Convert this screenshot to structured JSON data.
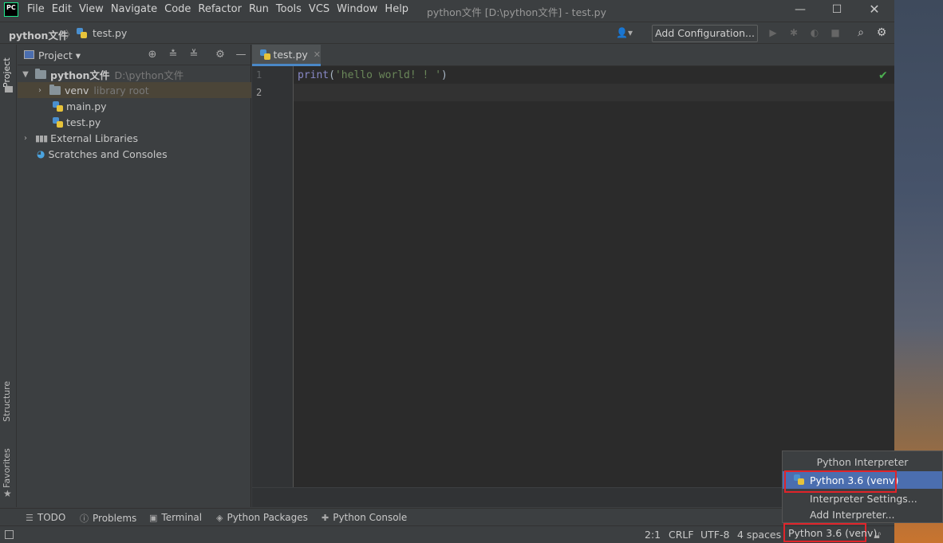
{
  "titlebar": {
    "logo": "PC",
    "menu": [
      "File",
      "Edit",
      "View",
      "Navigate",
      "Code",
      "Refactor",
      "Run",
      "Tools",
      "VCS",
      "Window",
      "Help"
    ],
    "window_title": "python文件 [D:\\python文件] - test.py",
    "controls": [
      "minimize",
      "maximize",
      "close"
    ]
  },
  "navbar": {
    "project": "python文件",
    "file": "test.py",
    "add_configuration": "Add Configuration..."
  },
  "left_strip": {
    "project_tab": "Project",
    "structure_tab": "Structure",
    "favorites_tab": "Favorites"
  },
  "project_panel": {
    "title": "Project",
    "tree": [
      {
        "label": "python文件",
        "hint": "D:\\python文件",
        "type": "folder",
        "expanded": true
      },
      {
        "label": "venv",
        "hint": "library root",
        "type": "folder",
        "expanded": false
      },
      {
        "label": "main.py",
        "type": "py"
      },
      {
        "label": "test.py",
        "type": "py"
      },
      {
        "label": "External Libraries",
        "type": "libs"
      },
      {
        "label": "Scratches and Consoles",
        "type": "scratch"
      }
    ]
  },
  "editor": {
    "tab": "test.py",
    "line_numbers": [
      "1",
      "2"
    ],
    "code": {
      "func": "print",
      "open": "(",
      "string": "'hello world! ! '",
      "close": ")"
    }
  },
  "tool_windows": [
    "TODO",
    "Problems",
    "Terminal",
    "Python Packages",
    "Python Console"
  ],
  "statusbar": {
    "position": "2:1",
    "line_sep": "CRLF",
    "encoding": "UTF-8",
    "indent": "4 spaces",
    "interpreter": "Python 3.6 (venv)"
  },
  "popup": {
    "title": "Python Interpreter",
    "selected": "Python 3.6 (venv)",
    "items": [
      "Interpreter Settings...",
      "Add Interpreter..."
    ]
  },
  "colors": {
    "accent": "#4b6eaf",
    "highlight_border": "#e0242a",
    "string": "#6a8759",
    "keyword": "#8888c6"
  }
}
